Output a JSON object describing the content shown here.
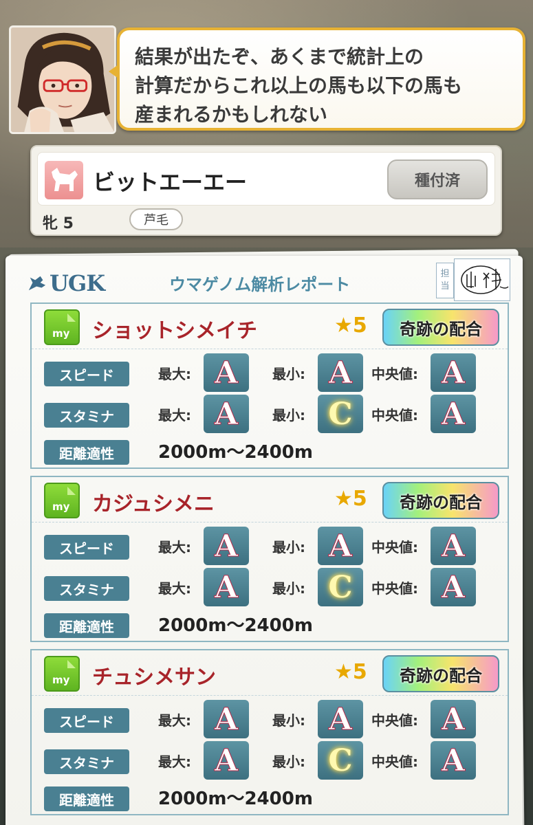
{
  "dialogue": {
    "text": "結果が出たぞ、あくまで統計上の\n計算だからこれ以上の馬も以下の馬も\n産まれるかもしれない"
  },
  "horse": {
    "name": "ビットエーエー",
    "bred_label": "種付済",
    "sex_age": "牝 5",
    "coat": "芦毛"
  },
  "report": {
    "logo": "UGK",
    "title": "ウマゲノム解析レポート",
    "stamp_label_1": "担",
    "stamp_label_2": "当",
    "stamp_signature": "山科"
  },
  "labels": {
    "speed": "スピード",
    "stamina": "スタミナ",
    "distance": "距離適性",
    "max": "最大:",
    "min": "最小:",
    "median": "中央値:",
    "my": "my",
    "miracle": "奇跡の配合"
  },
  "results": [
    {
      "name": "ショットシメイチ",
      "stars": "★5",
      "speed": {
        "max": "A",
        "min": "A",
        "median": "A"
      },
      "stamina": {
        "max": "A",
        "min": "C",
        "median": "A"
      },
      "distance": "2000m〜2400m"
    },
    {
      "name": "カジュシメニ",
      "stars": "★5",
      "speed": {
        "max": "A",
        "min": "A",
        "median": "A"
      },
      "stamina": {
        "max": "A",
        "min": "C",
        "median": "A"
      },
      "distance": "2000m〜2400m"
    },
    {
      "name": "チュシメサン",
      "stars": "★5",
      "speed": {
        "max": "A",
        "min": "A",
        "median": "A"
      },
      "stamina": {
        "max": "A",
        "min": "C",
        "median": "A"
      },
      "distance": "2000m〜2400m"
    }
  ],
  "colors": {
    "accent_gold": "#e7b234",
    "report_blue": "#4a8092",
    "horse_name_red": "#a8242a",
    "my_icon_green": "#5fb421"
  }
}
